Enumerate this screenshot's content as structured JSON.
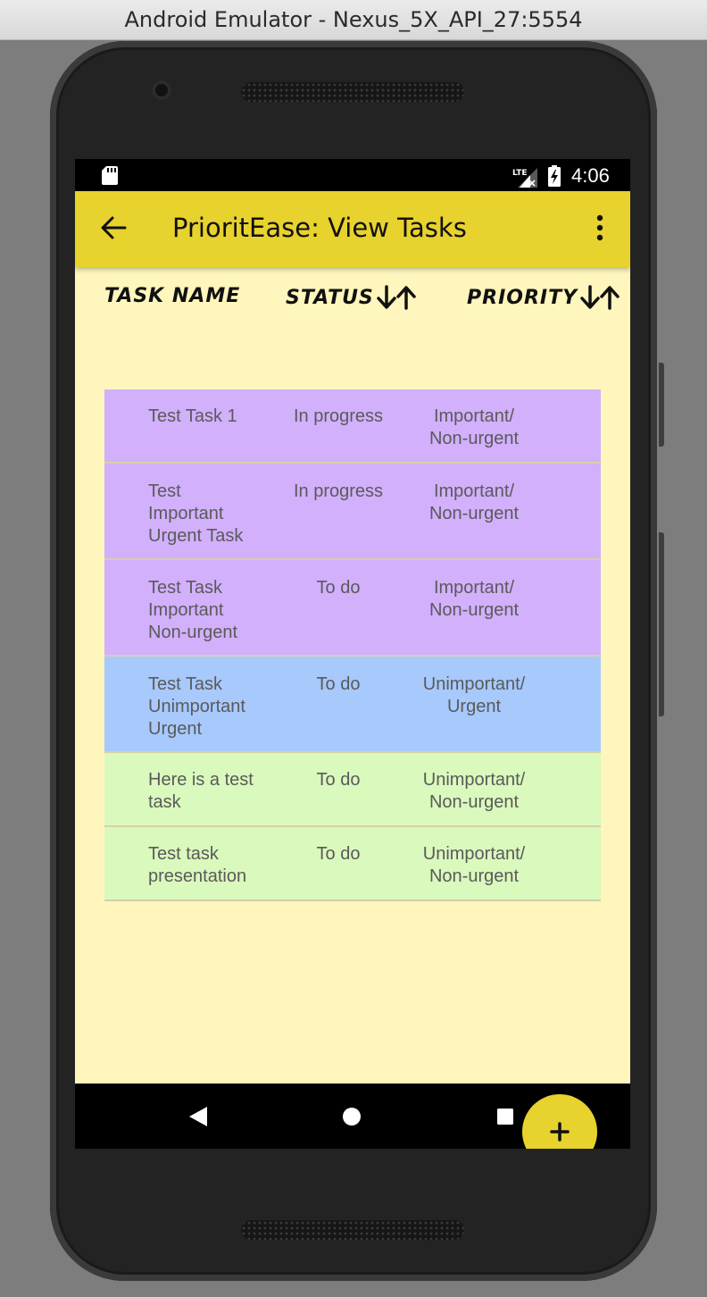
{
  "window": {
    "title": "Android Emulator - Nexus_5X_API_27:5554"
  },
  "statusbar": {
    "time": "4:06",
    "network": "LTE",
    "icons": [
      "sd-card-icon",
      "signal-lte-icon",
      "battery-charging-icon"
    ]
  },
  "appbar": {
    "title": "PrioritEase: View Tasks",
    "icons": {
      "back": "arrow-back-icon",
      "menu": "more-vert-icon"
    },
    "color": "#e8d22e"
  },
  "columns": {
    "name": "TASK NAME",
    "status": "STATUS",
    "priority": "PRIORITY"
  },
  "tasks": [
    {
      "name": "Test Task 1",
      "status": "In progress",
      "priority": "Important/\nNon-urgent",
      "color": "#d2b0fc"
    },
    {
      "name": "Test\nImportant\nUrgent Task",
      "status": "In progress",
      "priority": "Important/\nNon-urgent",
      "color": "#d2b0fc"
    },
    {
      "name": "Test Task\nImportant\nNon-urgent",
      "status": "To do",
      "priority": "Important/\nNon-urgent",
      "color": "#d2b0fc"
    },
    {
      "name": "Test Task\nUnimportant\nUrgent",
      "status": "To do",
      "priority": "Unimportant/\nUrgent",
      "color": "#a7c9fc"
    },
    {
      "name": "Here is a test\ntask",
      "status": "To do",
      "priority": "Unimportant/\nNon-urgent",
      "color": "#daf9bd"
    },
    {
      "name": "Test task\npresentation",
      "status": "To do",
      "priority": "Unimportant/\nNon-urgent",
      "color": "#daf9bd"
    }
  ],
  "fab": {
    "icon": "add-icon",
    "color": "#e8d22e"
  },
  "navbar": {
    "icons": [
      "nav-back-icon",
      "nav-home-icon",
      "nav-recents-icon"
    ]
  },
  "colors": {
    "background": "#fef6bc",
    "important": "#d2b0fc",
    "urgent": "#a7c9fc",
    "unimportant": "#daf9bd"
  }
}
